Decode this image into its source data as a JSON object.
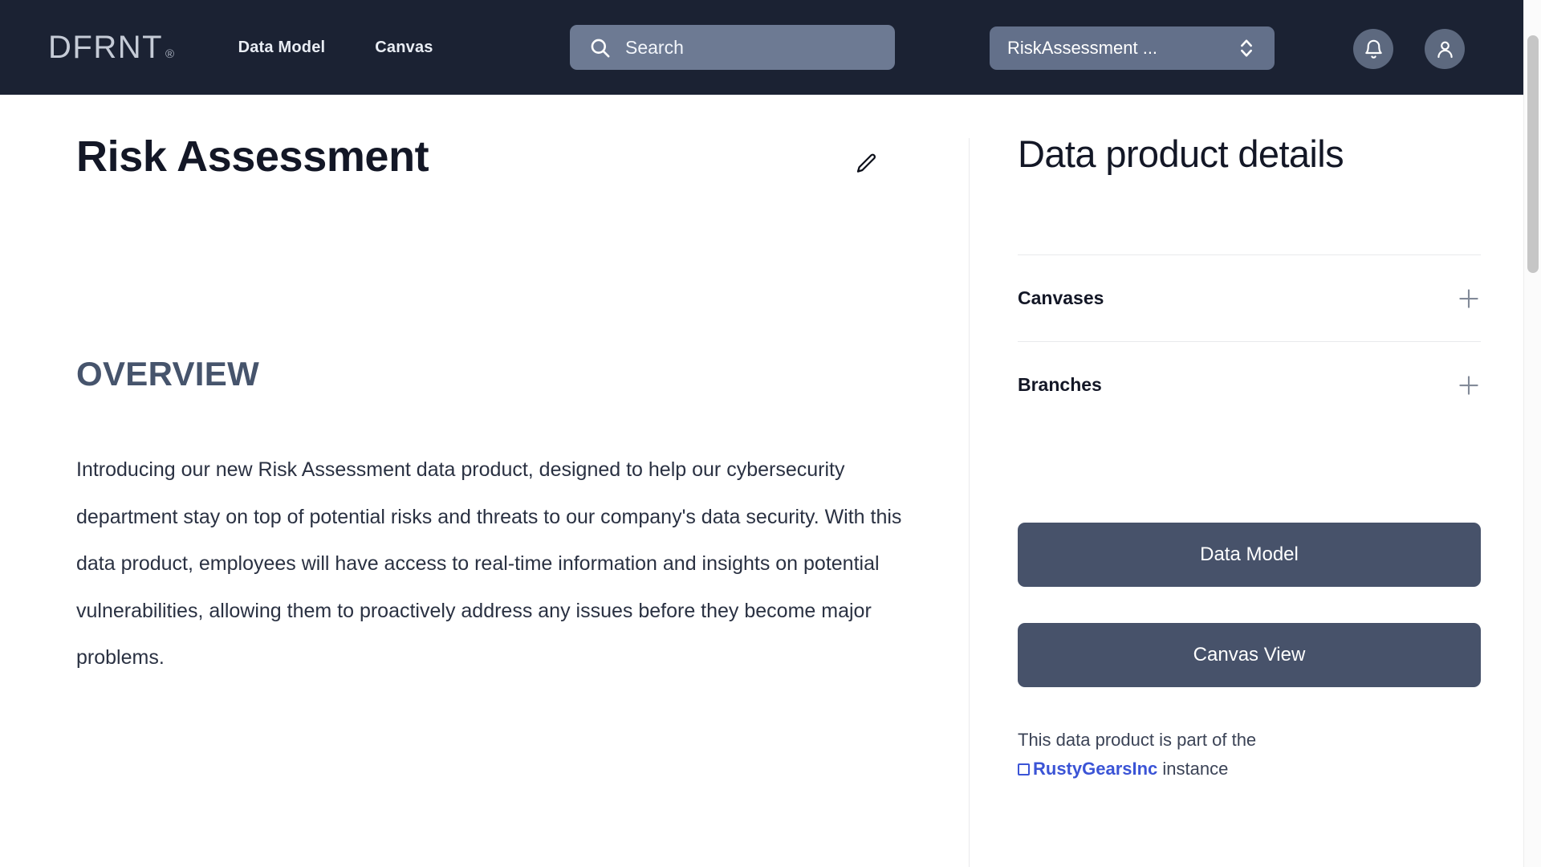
{
  "header": {
    "logo_text": "DFRNT",
    "logo_mark": "®",
    "nav": [
      {
        "label": "Data Model",
        "name": "nav-data-model"
      },
      {
        "label": "Canvas",
        "name": "nav-canvas"
      }
    ],
    "search": {
      "placeholder": "Search",
      "value": "",
      "icon": "search-icon"
    },
    "workspace_select": {
      "value": "RiskAssessment ...",
      "icon": "chevron-up-down-icon"
    },
    "notifications_icon": "bell-icon",
    "account_icon": "user-avatar-icon",
    "background_color": "#1b2233"
  },
  "main": {
    "title": "Risk Assessment",
    "edit_icon": "pencil-icon",
    "section_heading": "OVERVIEW",
    "section_heading_color": "#46546c",
    "body": "Introducing our new Risk Assessment data product, designed to help our cybersecurity department stay on top of potential risks and threats to our company's data security. With this data product, employees will have access to real-time information and insights on potential vulnerabilities, allowing them to proactively address any issues before they become major problems."
  },
  "sidebar": {
    "title": "Data product details",
    "rows": [
      {
        "label": "Canvases",
        "add_icon": "plus-icon"
      },
      {
        "label": "Branches",
        "add_icon": "plus-icon"
      }
    ],
    "buttons": [
      {
        "label": "Data Model",
        "color": "#47526a"
      },
      {
        "label": "Canvas View",
        "color": "#47526a"
      }
    ],
    "footnote_prefix": "This data product is part of the",
    "instance_link": "RustyGearsInc",
    "footnote_suffix": "instance",
    "link_color": "#3b54d6"
  },
  "scrollbar": {
    "thumb_color": "#c6c6c6"
  }
}
